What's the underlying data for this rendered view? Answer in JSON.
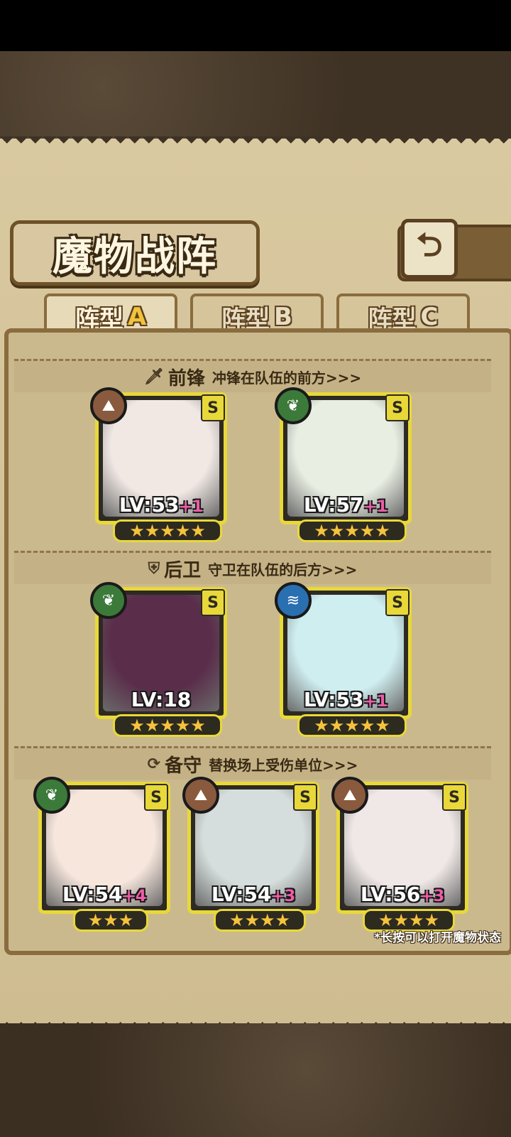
{
  "title": "魔物战阵",
  "back_icon": "back-arrow-icon",
  "tabs": [
    {
      "label": "阵型",
      "suffix": "A",
      "active": true
    },
    {
      "label": "阵型",
      "suffix": "B",
      "active": false
    },
    {
      "label": "阵型",
      "suffix": "C",
      "active": false
    }
  ],
  "sections": [
    {
      "icon": "sword-icon",
      "title": "前锋",
      "desc": "冲锋在队伍的前方>>>"
    },
    {
      "icon": "shield-icon",
      "title": "后卫",
      "desc": "守卫在队伍的后方>>>"
    },
    {
      "icon": "swap-icon",
      "title": "备守",
      "desc": "替换场上受伤单位>>>"
    }
  ],
  "cards": [
    {
      "section": 0,
      "level": "LV:53",
      "plus": "+1",
      "grade": "S",
      "element": "earth",
      "stars": 5,
      "tint": "#f1e8e4"
    },
    {
      "section": 0,
      "level": "LV:57",
      "plus": "+1",
      "grade": "S",
      "element": "nature",
      "stars": 5,
      "tint": "#e8eee2"
    },
    {
      "section": 1,
      "level": "LV:18",
      "plus": "",
      "grade": "S",
      "element": "nature",
      "stars": 5,
      "tint": "#5a2d4a"
    },
    {
      "section": 1,
      "level": "LV:53",
      "plus": "+1",
      "grade": "S",
      "element": "water",
      "stars": 5,
      "tint": "#cfeef0"
    },
    {
      "section": 2,
      "level": "LV:54",
      "plus": "+4",
      "grade": "S",
      "element": "nature",
      "stars": 3,
      "tint": "#f6e6dc"
    },
    {
      "section": 2,
      "level": "LV:54",
      "plus": "+3",
      "grade": "S",
      "element": "earth",
      "stars": 4,
      "tint": "#d5dedc"
    },
    {
      "section": 2,
      "level": "LV:56",
      "plus": "+3",
      "grade": "S",
      "element": "earth",
      "stars": 4,
      "tint": "#efe8e6"
    }
  ],
  "element_colors": {
    "earth": "#8a5a3e",
    "nature": "#3c7a3a",
    "water": "#2a6fb0"
  },
  "element_icons": {
    "earth": "mountain-icon",
    "nature": "leaf-icon",
    "water": "water-wave-icon"
  },
  "hint": "*长按可以打开魔物状态"
}
